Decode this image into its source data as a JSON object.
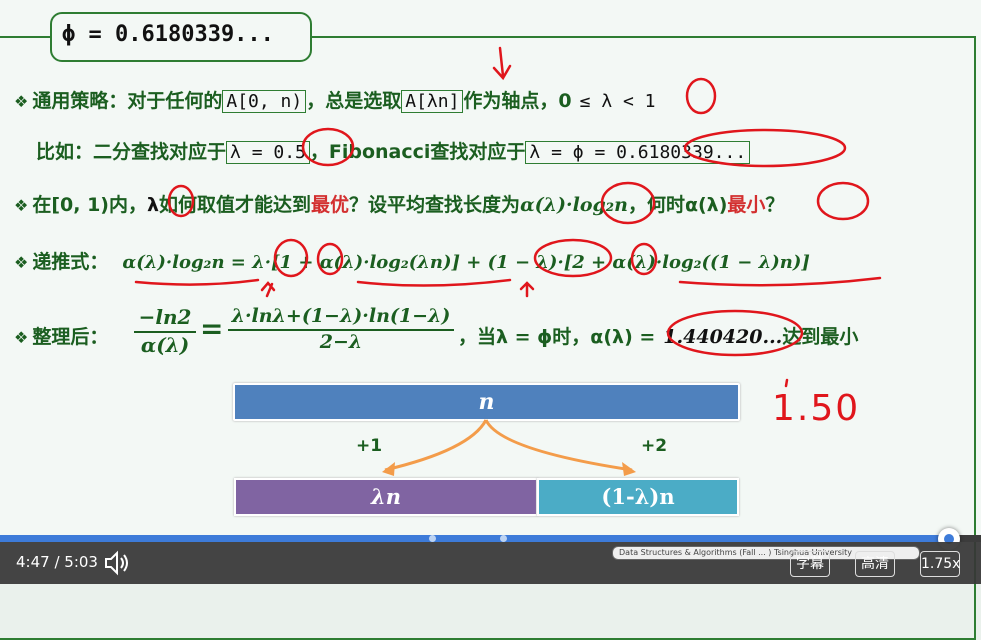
{
  "slide": {
    "phi": "ϕ = 0.6180339...",
    "line1": {
      "lead": "通用策略：对于任何的",
      "range": "A[0, n)",
      "mid": "，总是选取",
      "pivot": "A[λn]",
      "tail": "作为轴点，0",
      "cond": "≤ λ < 1"
    },
    "line2": {
      "lead": "比如：二分查找对应于",
      "binary": "λ = 0.5",
      "mid": "，Fibonacci查找对应于",
      "fib": "λ = ϕ = 0.6180339..."
    },
    "line3": {
      "lead": "在[0, 1)内，",
      "lam": "λ",
      "q1": "如何取值才能达到",
      "best": "最优",
      "q2": "？设平均查找长度为",
      "alpha": "α(λ)",
      "log": "·log₂n",
      "q3": "，何时α(λ)",
      "min": "最小",
      "q4": "？"
    },
    "line4": {
      "lead": "递推式：",
      "formula": "α(λ)·log₂n = λ·[1 + α(λ)·log₂(λn)] + (1 − λ)·[2 + α(λ)·log₂((1 − λ)n)]"
    },
    "line5": {
      "lead": "整理后：",
      "lhs_num": "−ln2",
      "lhs_den": "α(λ)",
      "eq": "=",
      "rhs_num": "λ·lnλ+(1−λ)·ln(1−λ)",
      "rhs_den": "2−λ",
      "tail": "，当λ = ϕ时，α(λ) =",
      "value": "1.440420...",
      "end": "达到最小"
    },
    "diagram": {
      "top": "n",
      "left_cost": "+1",
      "right_cost": "+2",
      "left": "λn",
      "right": "(1-λ)n"
    },
    "handwritten": "1.50"
  },
  "player": {
    "time": "4:47 / 5:03",
    "progress": 0.953,
    "buttons": [
      "字幕",
      "高清",
      "1.75x"
    ],
    "credit": "Data Structures & Algorithms (Fall ... ) Tsinghua University",
    "accent": "#3d7bd9"
  }
}
